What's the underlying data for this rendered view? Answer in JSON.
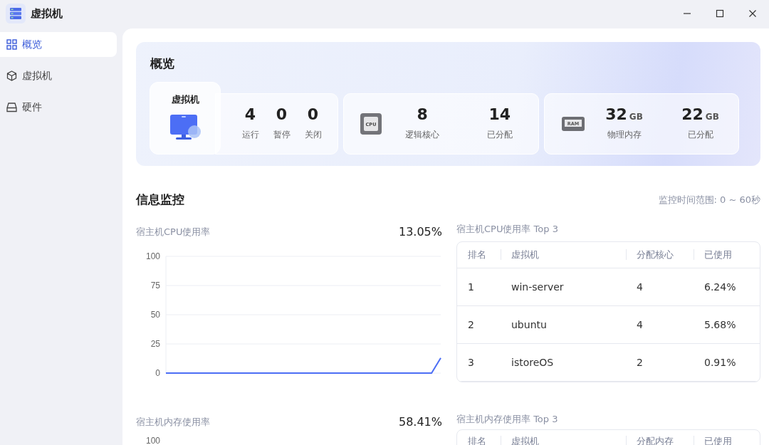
{
  "window": {
    "title": "虚拟机"
  },
  "sidebar": {
    "items": [
      {
        "label": "概览",
        "selected": true
      },
      {
        "label": "虚拟机",
        "selected": false
      },
      {
        "label": "硬件",
        "selected": false
      }
    ]
  },
  "overview": {
    "title": "概览",
    "vm": {
      "title": "虚拟机",
      "stats": [
        {
          "value": "4",
          "label": "运行"
        },
        {
          "value": "0",
          "label": "暂停"
        },
        {
          "value": "0",
          "label": "关闭"
        }
      ]
    },
    "cpu": {
      "chip_label": "CPU",
      "stats": [
        {
          "value": "8",
          "label": "逻辑核心"
        },
        {
          "value": "14",
          "label": "已分配"
        }
      ]
    },
    "ram": {
      "chip_label": "RAM",
      "stats": [
        {
          "value": "32",
          "unit": "GB",
          "label": "物理内存"
        },
        {
          "value": "22",
          "unit": "GB",
          "label": "已分配"
        }
      ]
    }
  },
  "monitor": {
    "title": "信息监控",
    "range": "监控时间范围: 0 ~ 60秒",
    "cpu_chart": {
      "label": "宿主机CPU使用率",
      "reading": "13.05%",
      "chart_data": {
        "type": "line",
        "grid": true,
        "ylim": [
          0,
          100
        ],
        "yticks": [
          0,
          25,
          50,
          75,
          100
        ],
        "series": [
          {
            "color": "#4c6ef5",
            "values": [
              0,
              0,
              0,
              0,
              0,
              0,
              0,
              0,
              0,
              0,
              0,
              0,
              0,
              0,
              0,
              0,
              0,
              0,
              0,
              0,
              0,
              0,
              0,
              0,
              0,
              0,
              0,
              0,
              0,
              0,
              13
            ]
          }
        ]
      }
    },
    "cpu_top": {
      "title": "宿主机CPU使用率 Top 3",
      "columns": [
        "排名",
        "虚拟机",
        "分配核心",
        "已使用"
      ],
      "rows": [
        [
          "1",
          "win-server",
          "4",
          "6.24%"
        ],
        [
          "2",
          "ubuntu",
          "4",
          "5.68%"
        ],
        [
          "3",
          "istoreOS",
          "2",
          "0.91%"
        ]
      ]
    },
    "mem_chart": {
      "label": "宿主机内存使用率",
      "reading": "58.41%",
      "top_tick": "100"
    },
    "mem_top": {
      "title": "宿主机内存使用率 Top 3",
      "columns": [
        "排名",
        "虚拟机",
        "分配内存",
        "已使用"
      ]
    }
  }
}
